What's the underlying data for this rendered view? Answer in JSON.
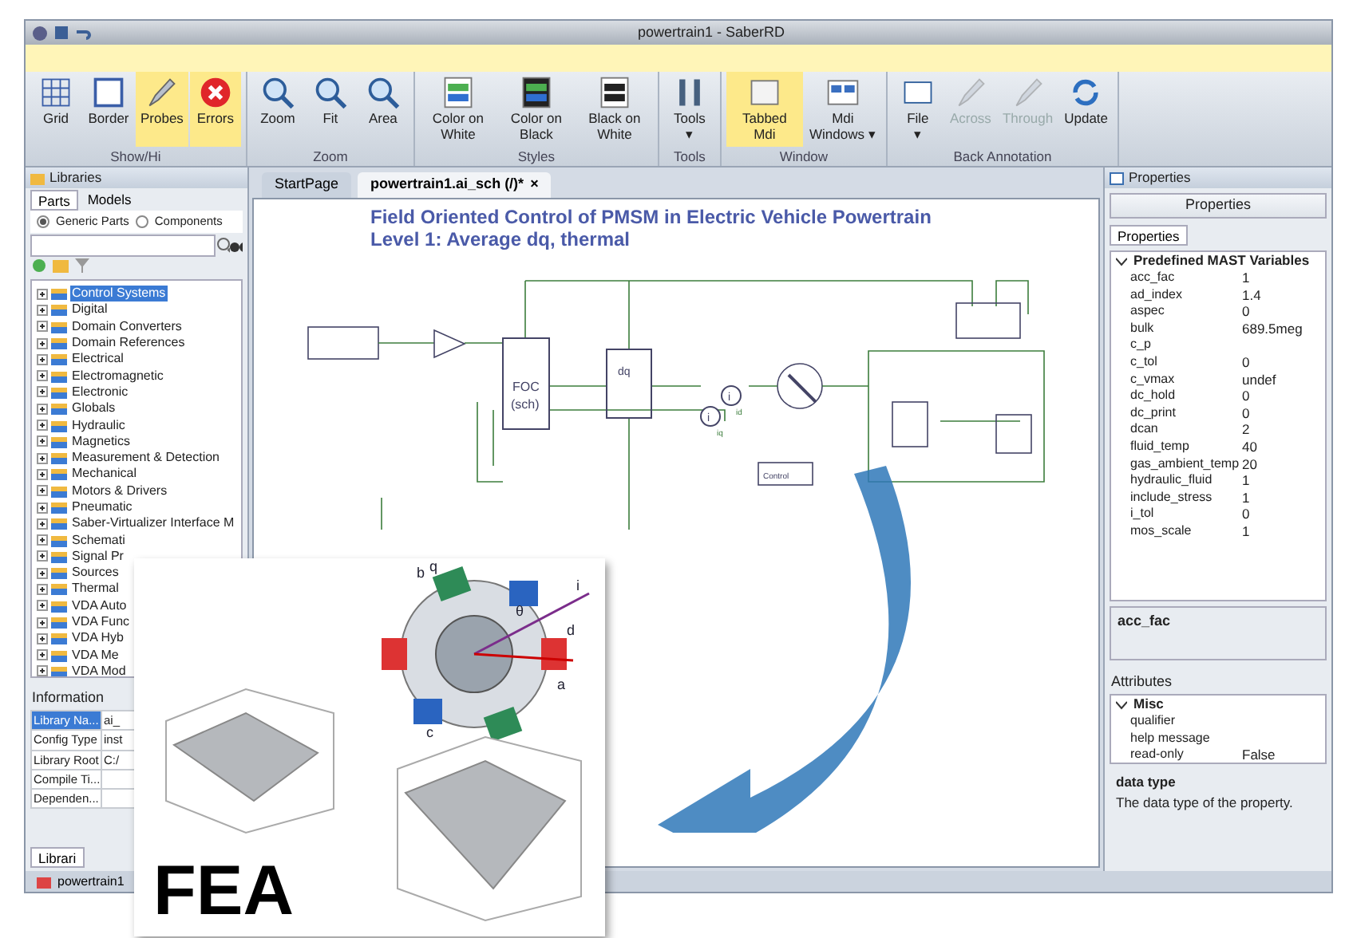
{
  "window": {
    "title": "powertrain1 - SaberRD"
  },
  "ribbon": {
    "groups": [
      {
        "label": "Show/Hi",
        "buttons": [
          {
            "label": "Grid",
            "kind": "grid",
            "highlighted": false,
            "disabled": false
          },
          {
            "label": "Border",
            "kind": "border",
            "highlighted": false,
            "disabled": false
          },
          {
            "label": "Probes",
            "kind": "probe",
            "highlighted": true,
            "disabled": false
          },
          {
            "label": "Errors",
            "kind": "error",
            "highlighted": true,
            "disabled": false
          }
        ]
      },
      {
        "label": "Zoom",
        "buttons": [
          {
            "label": "Zoom",
            "kind": "zoom",
            "highlighted": false,
            "disabled": false
          },
          {
            "label": "Fit",
            "kind": "zoom",
            "highlighted": false,
            "disabled": false
          },
          {
            "label": "Area",
            "kind": "zoom",
            "highlighted": false,
            "disabled": false
          }
        ]
      },
      {
        "label": "Styles",
        "buttons": [
          {
            "label": "Color on White",
            "kind": "cow",
            "highlighted": false,
            "disabled": false
          },
          {
            "label": "Color on Black",
            "kind": "cob",
            "highlighted": false,
            "disabled": false
          },
          {
            "label": "Black on White",
            "kind": "bow",
            "highlighted": false,
            "disabled": false
          }
        ]
      },
      {
        "label": "Tools",
        "buttons": [
          {
            "label": "Tools",
            "kind": "tools",
            "highlighted": false,
            "disabled": false,
            "caret": "▾"
          }
        ]
      },
      {
        "label": "Window",
        "buttons": [
          {
            "label": "Tabbed Mdi",
            "kind": "tabbed",
            "highlighted": true,
            "disabled": false
          },
          {
            "label": "Mdi Windows ▾",
            "kind": "windows",
            "highlighted": false,
            "disabled": false
          }
        ]
      },
      {
        "label": "Back Annotation",
        "buttons": [
          {
            "label": "File",
            "kind": "file",
            "highlighted": false,
            "disabled": false,
            "caret": "▾"
          },
          {
            "label": "Across",
            "kind": "probe",
            "highlighted": false,
            "disabled": true
          },
          {
            "label": "Through",
            "kind": "probe",
            "highlighted": false,
            "disabled": true
          },
          {
            "label": "Update",
            "kind": "update",
            "highlighted": false,
            "disabled": false
          }
        ]
      }
    ]
  },
  "libraries": {
    "title": "Libraries",
    "tabs": [
      {
        "label": "Parts",
        "selected": true
      },
      {
        "label": "Models",
        "selected": false
      }
    ],
    "radios": [
      {
        "label": "Generic Parts",
        "selected": true
      },
      {
        "label": "Components",
        "selected": false
      }
    ],
    "tree": [
      {
        "label": "Control Systems",
        "selected": true
      },
      {
        "label": "Digital",
        "selected": false
      },
      {
        "label": "Domain Converters",
        "selected": false
      },
      {
        "label": "Domain References",
        "selected": false
      },
      {
        "label": "Electrical",
        "selected": false
      },
      {
        "label": "Electromagnetic",
        "selected": false
      },
      {
        "label": "Electronic",
        "selected": false
      },
      {
        "label": "Globals",
        "selected": false
      },
      {
        "label": "Hydraulic",
        "selected": false
      },
      {
        "label": "Magnetics",
        "selected": false
      },
      {
        "label": "Measurement & Detection",
        "selected": false
      },
      {
        "label": "Mechanical",
        "selected": false
      },
      {
        "label": "Motors & Drivers",
        "selected": false
      },
      {
        "label": "Pneumatic",
        "selected": false
      },
      {
        "label": "Saber-Virtualizer Interface M",
        "selected": false
      },
      {
        "label": "Schemati",
        "selected": false
      },
      {
        "label": "Signal Pr",
        "selected": false
      },
      {
        "label": "Sources",
        "selected": false
      },
      {
        "label": "Thermal",
        "selected": false
      },
      {
        "label": "VDA Auto",
        "selected": false
      },
      {
        "label": "VDA Func",
        "selected": false
      },
      {
        "label": "VDA Hyb",
        "selected": false
      },
      {
        "label": "VDA Me",
        "selected": false
      },
      {
        "label": "VDA Mod",
        "selected": false
      }
    ]
  },
  "information": {
    "title": "Information",
    "rows": [
      {
        "name": "Library Na...",
        "value": "ai_",
        "selected": true
      },
      {
        "name": "Config Type",
        "value": "inst",
        "selected": false
      },
      {
        "name": "Library Root",
        "value": "C:/",
        "selected": false
      },
      {
        "name": "Compile Ti...",
        "selected": false
      },
      {
        "name": "Dependen...",
        "selected": false
      }
    ]
  },
  "bottom_tabs": [
    {
      "label": "Librari",
      "selected": true
    }
  ],
  "taskbar": {
    "item": "powertrain1"
  },
  "document_tabs": [
    {
      "label": "StartPage",
      "selected": false
    },
    {
      "label": "powertrain1.ai_sch (/)*",
      "selected": true,
      "close": "×"
    }
  ],
  "schematic": {
    "title": "Field Oriented Control of PMSM in Electric Vehicle Powertrain",
    "subtitle": "Level 1: Average dq, thermal",
    "blocks": [
      "FOC",
      "(sch)",
      "dq",
      "Control"
    ],
    "currents": [
      "i",
      "i"
    ],
    "current_labels": [
      "id",
      "iq"
    ]
  },
  "properties": {
    "title": "Properties",
    "dropdown": "Properties",
    "tab": "Properties",
    "group": {
      "label": "Predefined MAST Variables",
      "expanded": true
    },
    "rows": [
      {
        "name": "acc_fac",
        "value": "1"
      },
      {
        "name": "ad_index",
        "value": "1.4"
      },
      {
        "name": "aspec",
        "value": "0"
      },
      {
        "name": "bulk",
        "value": "689.5meg"
      },
      {
        "name": "c_p"
      },
      {
        "name": "c_tol",
        "value": "0"
      },
      {
        "name": "c_vmax",
        "value": "undef"
      },
      {
        "name": "dc_hold",
        "value": "0"
      },
      {
        "name": "dc_print",
        "value": "0"
      },
      {
        "name": "dcan",
        "value": "2"
      },
      {
        "name": "fluid_temp",
        "value": "40"
      },
      {
        "name": "gas_ambient_temp",
        "value": "20"
      },
      {
        "name": "hydraulic_fluid",
        "value": "1"
      },
      {
        "name": "include_stress",
        "value": "1"
      },
      {
        "name": "i_tol",
        "value": "0"
      },
      {
        "name": "mos_scale",
        "value": "1"
      }
    ],
    "description": "acc_fac",
    "attributes": {
      "title": "Attributes",
      "group": {
        "label": "Misc",
        "expanded": true
      },
      "rows": [
        {
          "name": "qualifier"
        },
        {
          "name": "help message"
        },
        {
          "name": "read-only",
          "value": "False"
        }
      ],
      "description_title": "data type",
      "description": "The data type of the property."
    }
  },
  "overlay": {
    "motor_labels": [
      "b",
      "q",
      "i",
      "θ",
      "d",
      "a",
      "c"
    ],
    "banner": "FEA"
  }
}
